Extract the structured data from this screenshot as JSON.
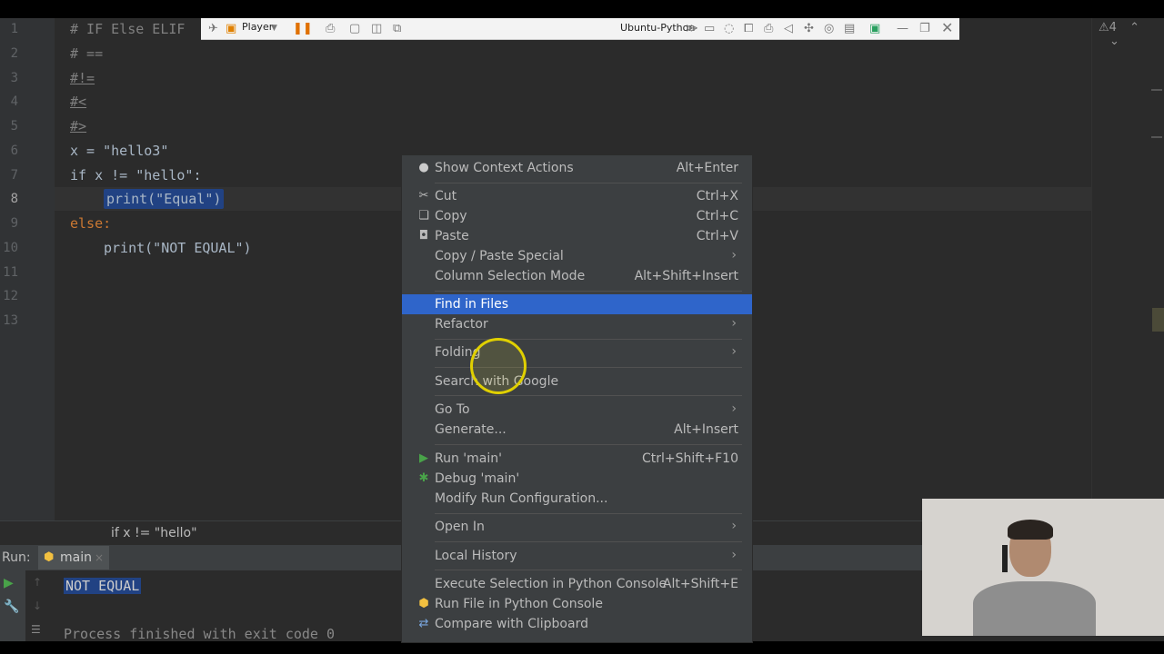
{
  "editor": {
    "lines": [
      {
        "no": "1",
        "code": "# IF Else ELIF"
      },
      {
        "no": "2",
        "code": "# =="
      },
      {
        "no": "3",
        "code": "#!="
      },
      {
        "no": "4",
        "code": "#<"
      },
      {
        "no": "5",
        "code": "#>"
      },
      {
        "no": "6",
        "code": "x = \"hello3\""
      },
      {
        "no": "7",
        "code": "if x != \"hello\":"
      },
      {
        "no": "8",
        "code": "print(\"Equal\")"
      },
      {
        "no": "9",
        "code": "else:"
      },
      {
        "no": "10",
        "code": "print(\"NOT EQUAL\")"
      },
      {
        "no": "11",
        "code": ""
      },
      {
        "no": "12",
        "code": ""
      },
      {
        "no": "13",
        "code": ""
      }
    ],
    "warnings_count": "4",
    "breadcrumb": "if x != \"hello\""
  },
  "vmware": {
    "player_label": "Player",
    "vm_title": "Ubuntu-Python"
  },
  "run_panel": {
    "label": "Run:",
    "tab": "main",
    "output": "NOT EQUAL",
    "process": "Process finished with exit code 0"
  },
  "context_menu": {
    "items": [
      {
        "label": "Show Context Actions",
        "shortcut": "Alt+Enter",
        "icon": "lightbulb-icon"
      },
      {
        "label": "Cut",
        "shortcut": "Ctrl+X",
        "icon": "scissors-icon"
      },
      {
        "label": "Copy",
        "shortcut": "Ctrl+C",
        "icon": "copy-icon"
      },
      {
        "label": "Paste",
        "shortcut": "Ctrl+V",
        "icon": "clipboard-icon"
      },
      {
        "label": "Copy / Paste Special",
        "shortcut": "",
        "submenu": true
      },
      {
        "label": "Column Selection Mode",
        "shortcut": "Alt+Shift+Insert"
      },
      {
        "label": "Find in Files",
        "shortcut": "",
        "highlighted": true
      },
      {
        "label": "Refactor",
        "shortcut": "",
        "submenu": true
      },
      {
        "label": "Folding",
        "shortcut": "",
        "submenu": true
      },
      {
        "label": "Search with Google",
        "shortcut": ""
      },
      {
        "label": "Go To",
        "shortcut": "",
        "submenu": true
      },
      {
        "label": "Generate...",
        "shortcut": "Alt+Insert"
      },
      {
        "label": "Run 'main'",
        "shortcut": "Ctrl+Shift+F10",
        "icon": "run-icon"
      },
      {
        "label": "Debug 'main'",
        "shortcut": "",
        "icon": "debug-icon"
      },
      {
        "label": "Modify Run Configuration...",
        "shortcut": ""
      },
      {
        "label": "Open In",
        "shortcut": "",
        "submenu": true
      },
      {
        "label": "Local History",
        "shortcut": "",
        "submenu": true
      },
      {
        "label": "Execute Selection in Python Console",
        "shortcut": "Alt+Shift+E"
      },
      {
        "label": "Run File in Python Console",
        "shortcut": "",
        "icon": "python-icon"
      },
      {
        "label": "Compare with Clipboard",
        "shortcut": "",
        "icon": "compare-icon"
      }
    ]
  },
  "colors": {
    "highlight": "#2f65ca",
    "selection": "#214283",
    "editor_bg": "#2b2b2b",
    "menu_bg": "#3c3f41"
  }
}
